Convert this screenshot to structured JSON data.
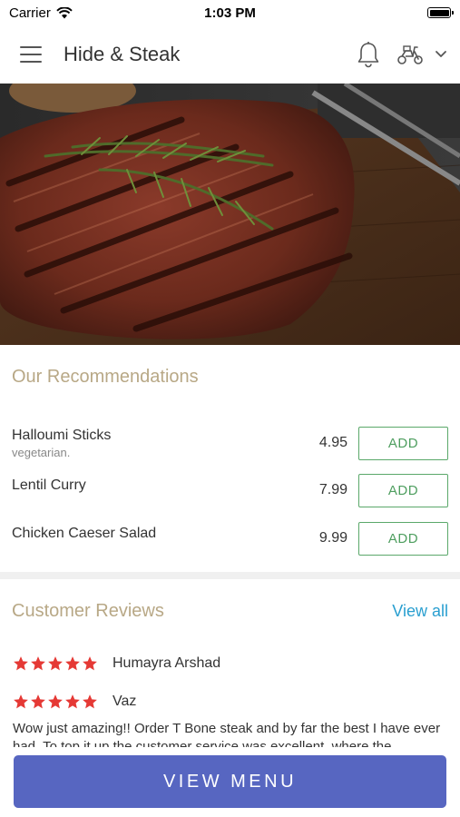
{
  "status_bar": {
    "carrier": "Carrier",
    "time": "1:03 PM"
  },
  "header": {
    "title": "Hide & Steak",
    "icons": [
      "menu-icon",
      "bell-icon",
      "scooter-icon",
      "chevron-down-icon"
    ]
  },
  "recommendations": {
    "title": "Our Recommendations",
    "items": [
      {
        "name": "Halloumi Sticks",
        "description": "vegetarian.",
        "price": "4.95",
        "button": "ADD"
      },
      {
        "name": "Lentil Curry",
        "description": "",
        "price": "7.99",
        "button": "ADD"
      },
      {
        "name": "Chicken Caeser Salad",
        "description": "",
        "price": "9.99",
        "button": "ADD"
      }
    ]
  },
  "reviews": {
    "title": "Customer Reviews",
    "view_all": "View all",
    "items": [
      {
        "name": "Humayra Arshad",
        "rating": 5
      },
      {
        "name": "Vaz",
        "rating": 5,
        "text": "Wow just amazing!! Order T Bone steak and by far the best I have ever had. To top it up the customer service was excellent, where the"
      }
    ]
  },
  "footer": {
    "button": "VIEW MENU"
  },
  "colors": {
    "accent": "#5766c1",
    "add_green": "#4e9e5f",
    "section_title": "#b8a886",
    "link": "#2a9fd0",
    "star": "#e53935"
  }
}
